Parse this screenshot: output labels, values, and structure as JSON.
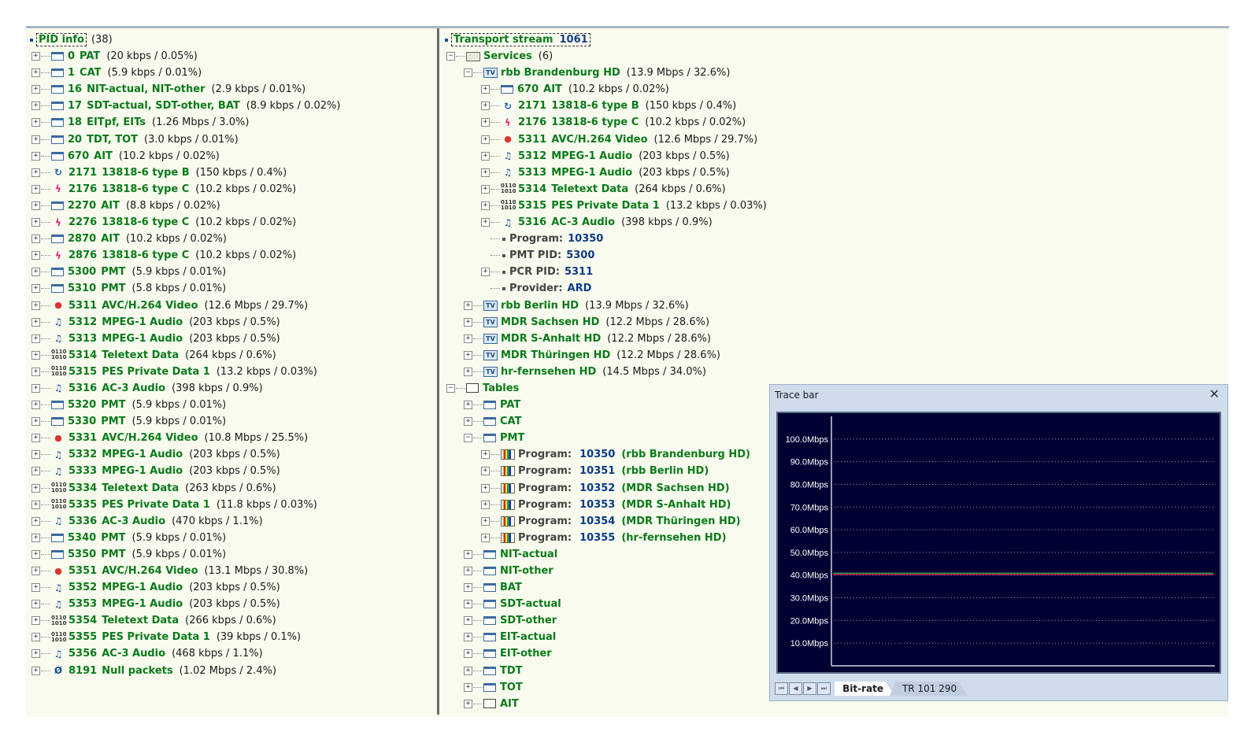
{
  "pid_info": {
    "title": "PID info",
    "count": "(38)",
    "rows": [
      {
        "icon": "table",
        "pid": "0",
        "name": "PAT",
        "rate": "(20 kbps / 0.05%)"
      },
      {
        "icon": "table",
        "pid": "1",
        "name": "CAT",
        "rate": "(5.9 kbps / 0.01%)"
      },
      {
        "icon": "table",
        "pid": "16",
        "name": "NIT-actual, NIT-other",
        "rate": "(2.9 kbps / 0.01%)"
      },
      {
        "icon": "table",
        "pid": "17",
        "name": "SDT-actual, SDT-other, BAT",
        "rate": "(8.9 kbps / 0.02%)"
      },
      {
        "icon": "table",
        "pid": "18",
        "name": "EITpf, EITs",
        "rate": "(1.26 Mbps / 3.0%)"
      },
      {
        "icon": "table",
        "pid": "20",
        "name": "TDT, TOT",
        "rate": "(3.0 kbps / 0.01%)"
      },
      {
        "icon": "table",
        "pid": "670",
        "name": "AIT",
        "rate": "(10.2 kbps / 0.02%)"
      },
      {
        "icon": "dsmcc",
        "pid": "2171",
        "name": "13818-6 type B",
        "rate": "(150 kbps / 0.4%)"
      },
      {
        "icon": "mpe",
        "pid": "2176",
        "name": "13818-6 type C",
        "rate": "(10.2 kbps / 0.02%)"
      },
      {
        "icon": "table",
        "pid": "2270",
        "name": "AIT",
        "rate": "(8.8 kbps / 0.02%)"
      },
      {
        "icon": "mpe",
        "pid": "2276",
        "name": "13818-6 type C",
        "rate": "(10.2 kbps / 0.02%)"
      },
      {
        "icon": "table",
        "pid": "2870",
        "name": "AIT",
        "rate": "(10.2 kbps / 0.02%)"
      },
      {
        "icon": "mpe",
        "pid": "2876",
        "name": "13818-6 type C",
        "rate": "(10.2 kbps / 0.02%)"
      },
      {
        "icon": "table",
        "pid": "5300",
        "name": "PMT",
        "rate": "(5.9 kbps / 0.01%)"
      },
      {
        "icon": "table",
        "pid": "5310",
        "name": "PMT",
        "rate": "(5.8 kbps / 0.01%)"
      },
      {
        "icon": "video",
        "pid": "5311",
        "name": "AVC/H.264 Video",
        "rate": "(12.6 Mbps / 29.7%)"
      },
      {
        "icon": "audio",
        "pid": "5312",
        "name": "MPEG-1 Audio",
        "rate": "(203 kbps / 0.5%)"
      },
      {
        "icon": "audio",
        "pid": "5313",
        "name": "MPEG-1 Audio",
        "rate": "(203 kbps / 0.5%)"
      },
      {
        "icon": "data",
        "pid": "5314",
        "name": "Teletext Data",
        "rate": "(264 kbps / 0.6%)"
      },
      {
        "icon": "data",
        "pid": "5315",
        "name": "PES Private Data 1",
        "rate": "(13.2 kbps / 0.03%)"
      },
      {
        "icon": "audio",
        "pid": "5316",
        "name": "AC-3 Audio",
        "rate": "(398 kbps / 0.9%)"
      },
      {
        "icon": "table",
        "pid": "5320",
        "name": "PMT",
        "rate": "(5.9 kbps / 0.01%)"
      },
      {
        "icon": "table",
        "pid": "5330",
        "name": "PMT",
        "rate": "(5.9 kbps / 0.01%)"
      },
      {
        "icon": "video",
        "pid": "5331",
        "name": "AVC/H.264 Video",
        "rate": "(10.8 Mbps / 25.5%)"
      },
      {
        "icon": "audio",
        "pid": "5332",
        "name": "MPEG-1 Audio",
        "rate": "(203 kbps / 0.5%)"
      },
      {
        "icon": "audio",
        "pid": "5333",
        "name": "MPEG-1 Audio",
        "rate": "(203 kbps / 0.5%)"
      },
      {
        "icon": "data",
        "pid": "5334",
        "name": "Teletext Data",
        "rate": "(263 kbps / 0.6%)"
      },
      {
        "icon": "data",
        "pid": "5335",
        "name": "PES Private Data 1",
        "rate": "(11.8 kbps / 0.03%)"
      },
      {
        "icon": "audio",
        "pid": "5336",
        "name": "AC-3 Audio",
        "rate": "(470 kbps / 1.1%)"
      },
      {
        "icon": "table",
        "pid": "5340",
        "name": "PMT",
        "rate": "(5.9 kbps / 0.01%)"
      },
      {
        "icon": "table",
        "pid": "5350",
        "name": "PMT",
        "rate": "(5.9 kbps / 0.01%)"
      },
      {
        "icon": "video",
        "pid": "5351",
        "name": "AVC/H.264 Video",
        "rate": "(13.1 Mbps / 30.8%)"
      },
      {
        "icon": "audio",
        "pid": "5352",
        "name": "MPEG-1 Audio",
        "rate": "(203 kbps / 0.5%)"
      },
      {
        "icon": "audio",
        "pid": "5353",
        "name": "MPEG-1 Audio",
        "rate": "(203 kbps / 0.5%)"
      },
      {
        "icon": "data",
        "pid": "5354",
        "name": "Teletext Data",
        "rate": "(266 kbps / 0.6%)"
      },
      {
        "icon": "data",
        "pid": "5355",
        "name": "PES Private Data 1",
        "rate": "(39 kbps / 0.1%)"
      },
      {
        "icon": "audio",
        "pid": "5356",
        "name": "AC-3 Audio",
        "rate": "(468 kbps / 1.1%)"
      },
      {
        "icon": "null",
        "pid": "8191",
        "name": "Null packets",
        "rate": "(1.02 Mbps / 2.4%)"
      }
    ]
  },
  "transport_stream": {
    "title": "Transport stream",
    "id": "1061",
    "services_label": "Services",
    "services_count": "(6)",
    "expanded_service": {
      "name": "rbb Brandenburg HD",
      "rate": "(13.9 Mbps / 32.6%)",
      "components": [
        {
          "icon": "table",
          "pid": "670",
          "name": "AIT",
          "rate": "(10.2 kbps / 0.02%)"
        },
        {
          "icon": "dsmcc",
          "pid": "2171",
          "name": "13818-6 type B",
          "rate": "(150 kbps / 0.4%)"
        },
        {
          "icon": "mpe",
          "pid": "2176",
          "name": "13818-6 type C",
          "rate": "(10.2 kbps / 0.02%)"
        },
        {
          "icon": "video",
          "pid": "5311",
          "name": "AVC/H.264 Video",
          "rate": "(12.6 Mbps / 29.7%)"
        },
        {
          "icon": "audio",
          "pid": "5312",
          "name": "MPEG-1 Audio",
          "rate": "(203 kbps / 0.5%)"
        },
        {
          "icon": "audio",
          "pid": "5313",
          "name": "MPEG-1 Audio",
          "rate": "(203 kbps / 0.5%)"
        },
        {
          "icon": "data",
          "pid": "5314",
          "name": "Teletext Data",
          "rate": "(264 kbps / 0.6%)"
        },
        {
          "icon": "data",
          "pid": "5315",
          "name": "PES Private Data 1",
          "rate": "(13.2 kbps / 0.03%)"
        },
        {
          "icon": "audio",
          "pid": "5316",
          "name": "AC-3 Audio",
          "rate": "(398 kbps / 0.9%)"
        }
      ],
      "properties": [
        {
          "label": "Program:",
          "value": "10350",
          "expander": false
        },
        {
          "label": "PMT PID:",
          "value": "5300",
          "expander": false
        },
        {
          "label": "PCR PID:",
          "value": "5311",
          "expander": true
        },
        {
          "label": "Provider:",
          "value": "ARD",
          "expander": false
        }
      ]
    },
    "other_services": [
      {
        "name": "rbb Berlin HD",
        "rate": "(13.9 Mbps / 32.6%)"
      },
      {
        "name": "MDR Sachsen HD",
        "rate": "(12.2 Mbps / 28.6%)"
      },
      {
        "name": "MDR S-Anhalt HD",
        "rate": "(12.2 Mbps / 28.6%)"
      },
      {
        "name": "MDR Thüringen HD",
        "rate": "(12.2 Mbps / 28.6%)"
      },
      {
        "name": "hr-fernsehen HD",
        "rate": "(14.5 Mbps / 34.0%)"
      }
    ],
    "tables_label": "Tables",
    "tables_before_pmt": [
      "PAT",
      "CAT"
    ],
    "pmt_label": "PMT",
    "pmt_programs": [
      {
        "label": "Program:",
        "value": "10350",
        "service": "(rbb Brandenburg HD)"
      },
      {
        "label": "Program:",
        "value": "10351",
        "service": "(rbb Berlin HD)"
      },
      {
        "label": "Program:",
        "value": "10352",
        "service": "(MDR Sachsen HD)"
      },
      {
        "label": "Program:",
        "value": "10353",
        "service": "(MDR S-Anhalt HD)"
      },
      {
        "label": "Program:",
        "value": "10354",
        "service": "(MDR Thüringen HD)"
      },
      {
        "label": "Program:",
        "value": "10355",
        "service": "(hr-fernsehen HD)"
      }
    ],
    "tables_after_pmt": [
      "NIT-actual",
      "NIT-other",
      "BAT",
      "SDT-actual",
      "SDT-other",
      "EIT-actual",
      "EIT-other",
      "TDT",
      "TOT"
    ],
    "ait_label": "AIT"
  },
  "trace_bar": {
    "title": "Trace bar",
    "close_label": "✕",
    "tabs": {
      "bit_rate": "Bit-rate",
      "tr": "TR 101 290"
    },
    "nav": [
      "⏮",
      "◀",
      "▶",
      "⏭"
    ]
  },
  "chart_data": {
    "type": "line",
    "title": "",
    "y_tick_labels": [
      "100.0Mbps",
      "90.0Mbps",
      "80.0Mbps",
      "70.0Mbps",
      "60.0Mbps",
      "50.0Mbps",
      "40.0Mbps",
      "30.0Mbps",
      "20.0Mbps",
      "10.0Mbps"
    ],
    "ylim": [
      0,
      110
    ],
    "y_ticks": [
      100,
      90,
      80,
      70,
      60,
      50,
      40,
      30,
      20,
      10
    ],
    "grid": true,
    "series": [
      {
        "color": "#2aa84a",
        "values": [
          40.8,
          40.8,
          40.8,
          40.8,
          40.8,
          40.8,
          40.8,
          40.8,
          40.8,
          40.8
        ]
      },
      {
        "color": "#c8205a",
        "values": [
          40.2,
          40.2,
          40.2,
          40.2,
          40.2,
          40.2,
          40.2,
          40.2,
          40.2,
          40.2
        ]
      }
    ]
  }
}
